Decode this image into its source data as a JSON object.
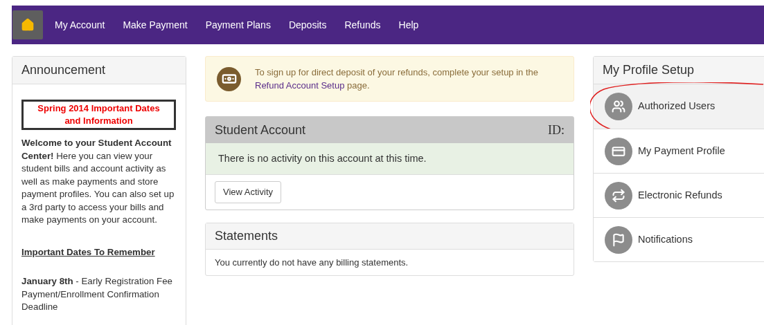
{
  "nav": {
    "items": [
      {
        "label": "My Account"
      },
      {
        "label": "Make Payment"
      },
      {
        "label": "Payment Plans"
      },
      {
        "label": "Deposits"
      },
      {
        "label": "Refunds"
      },
      {
        "label": "Help"
      }
    ]
  },
  "announcement": {
    "title": "Announcement",
    "banner": "Spring 2014 Important Dates and Information",
    "welcome": "**Welcome to your Student Account Center!** Here you can view your student bills and account activity as well as make payments and store payment profiles. You can also set up a 3rd party to access your bills and make payments on your account.",
    "dates_heading": "Important Dates To Remember",
    "dates": [
      "**January 8th** - Early Registration Fee Payment/Enrollment Confirmation Deadline"
    ]
  },
  "alert": {
    "text": "To sign up for direct deposit of your refunds, complete your setup in the",
    "link": "Refund Account Setup",
    "after": "page."
  },
  "student_account": {
    "title": "Student Account",
    "id_label": "ID:",
    "message": "There is no activity on this account at this time.",
    "button": "View Activity"
  },
  "statements": {
    "title": "Statements",
    "message": "You currently do not have any billing statements."
  },
  "profile_setup": {
    "title": "My Profile Setup",
    "items": [
      {
        "label": "Authorized Users",
        "kind": "users",
        "selected": true,
        "circled": true
      },
      {
        "label": "My Payment Profile",
        "kind": "card",
        "selected": false,
        "circled": false
      },
      {
        "label": "Electronic Refunds",
        "kind": "refresh",
        "selected": false,
        "circled": false
      },
      {
        "label": "Notifications",
        "kind": "flag",
        "selected": false,
        "circled": false
      }
    ]
  }
}
